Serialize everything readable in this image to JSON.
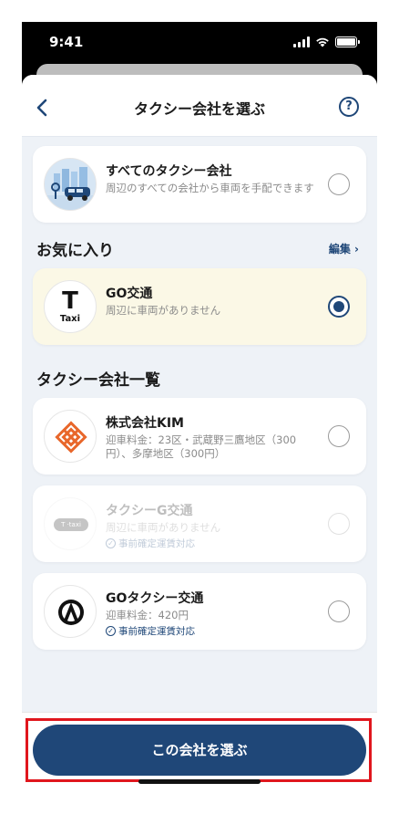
{
  "status_bar": {
    "time": "9:41"
  },
  "header": {
    "title": "タクシー会社を選ぶ",
    "help_label": "?"
  },
  "all_companies": {
    "name": "すべてのタクシー会社",
    "description": "周辺のすべての会社から車両を手配できます"
  },
  "favorites": {
    "section_title": "お気に入り",
    "edit_label": "編集 ›",
    "items": [
      {
        "name": "GO交通",
        "subtitle": "周辺に車両がありません",
        "logo_text": "T",
        "logo_sub": "Taxi",
        "selected": true
      }
    ]
  },
  "company_list": {
    "section_title": "タクシー会社一覧",
    "items": [
      {
        "name": "株式会社KIM",
        "subtitle": "迎車料金：23区・武蔵野三鷹地区（300円）、多摩地区（300円）",
        "badge": "",
        "disabled": false
      },
      {
        "name": "タクシーG交通",
        "subtitle": "周辺に車両がありません",
        "badge": "事前確定運賃対応",
        "logo_text": "T ·taxi",
        "disabled": true
      },
      {
        "name": "GOタクシー交通",
        "subtitle": "迎車料金：420円",
        "badge": "事前確定運賃対応",
        "disabled": false
      }
    ]
  },
  "footer": {
    "cta_label": "この会社を選ぶ"
  },
  "colors": {
    "accent": "#1f4778",
    "favorite_bg": "#fbf8e6",
    "page_bg": "#eef2f7",
    "highlight": "#e0161d"
  }
}
